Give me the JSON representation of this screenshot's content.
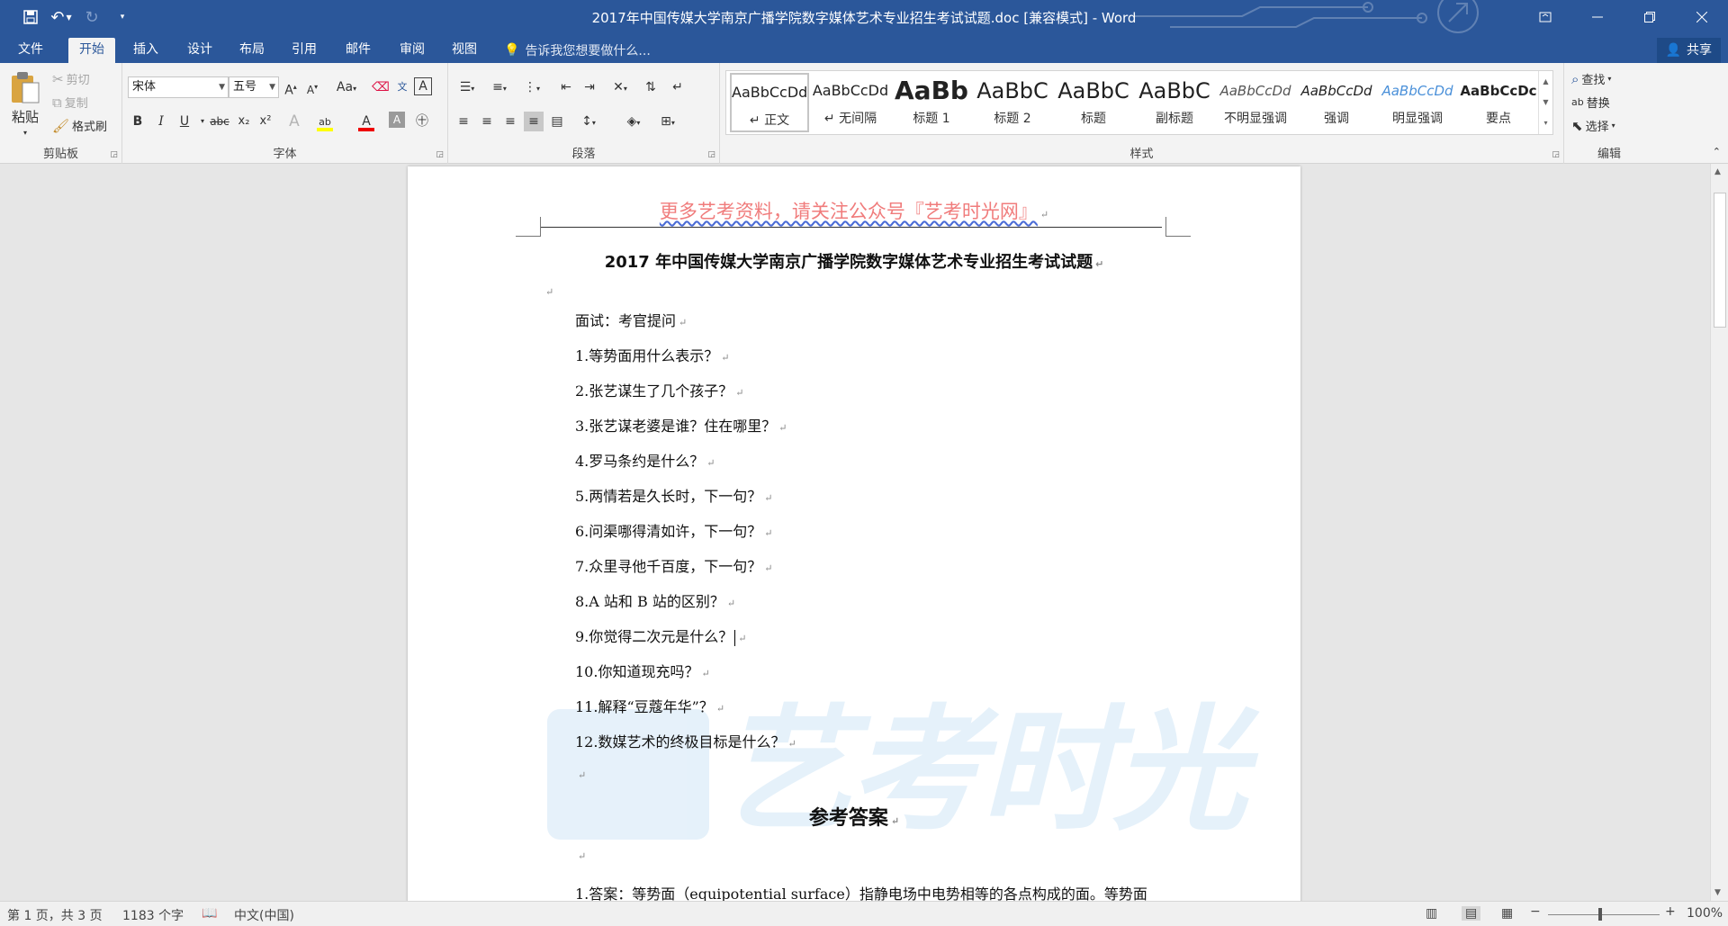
{
  "app": {
    "title": "2017年中国传媒大学南京广播学院数字媒体艺术专业招生考试试题.doc [兼容模式] - Word"
  },
  "tabs": [
    {
      "label": "文件"
    },
    {
      "label": "开始"
    },
    {
      "label": "插入"
    },
    {
      "label": "设计"
    },
    {
      "label": "布局"
    },
    {
      "label": "引用"
    },
    {
      "label": "邮件"
    },
    {
      "label": "审阅"
    },
    {
      "label": "视图"
    }
  ],
  "tellme": "告诉我您想要做什么...",
  "share": "共享",
  "clipboard": {
    "paste": "粘贴",
    "cut": "剪切",
    "copy": "复制",
    "format_painter": "格式刷",
    "label": "剪贴板"
  },
  "font": {
    "name": "宋体",
    "size": "五号",
    "label": "字体",
    "bold": "B",
    "italic": "I",
    "underline": "U",
    "strike": "abc",
    "sub": "x₂",
    "sup": "x²",
    "change_case": "Aa",
    "grow": "A",
    "shrink": "A"
  },
  "paragraph": {
    "label": "段落"
  },
  "styles": {
    "label": "样式",
    "items": [
      {
        "sample": "AaBbCcDd",
        "name": "↵ 正文"
      },
      {
        "sample": "AaBbCcDd",
        "name": "↵ 无间隔"
      },
      {
        "sample": "AaBb",
        "name": "标题 1"
      },
      {
        "sample": "AaBbC",
        "name": "标题 2"
      },
      {
        "sample": "AaBbC",
        "name": "标题"
      },
      {
        "sample": "AaBbC",
        "name": "副标题"
      },
      {
        "sample": "AaBbCcDd",
        "name": "不明显强调"
      },
      {
        "sample": "AaBbCcDd",
        "name": "强调"
      },
      {
        "sample": "AaBbCcDd",
        "name": "明显强调"
      },
      {
        "sample": "AaBbCcDc",
        "name": "要点"
      }
    ]
  },
  "editing": {
    "find": "查找",
    "replace": "替换",
    "select": "选择",
    "label": "编辑"
  },
  "document": {
    "header": "更多艺考资料，请关注公众号『艺考时光网』",
    "title": "2017 年中国传媒大学南京广播学院数字媒体艺术专业招生考试试题",
    "intro": "面试：考官提问",
    "questions": [
      "1.等势面用什么表示？",
      "2.张艺谋生了几个孩子？",
      "3.张艺谋老婆是谁？住在哪里？",
      "4.罗马条约是什么？",
      "5.两情若是久长时，下一句？",
      "6.问渠哪得清如许，下一句？",
      "7.众里寻他千百度，下一句？",
      "8.A 站和 B 站的区别？",
      "9.你觉得二次元是什么？",
      "10.你知道现充吗？",
      "11.解释“豆蔻年华”？",
      "12.数媒艺术的终极目标是什么？"
    ],
    "answer_heading": "参考答案",
    "answer_1": "1.答案：等势面（equipotential surface）指静电场中电势相等的各点构成的面。等势面",
    "watermark": "艺考时光",
    "paragraph_mark": "↵"
  },
  "status": {
    "page": "第 1 页，共 3 页",
    "words": "1183 个字",
    "lang": "中文(中国)",
    "zoom": "100%"
  }
}
